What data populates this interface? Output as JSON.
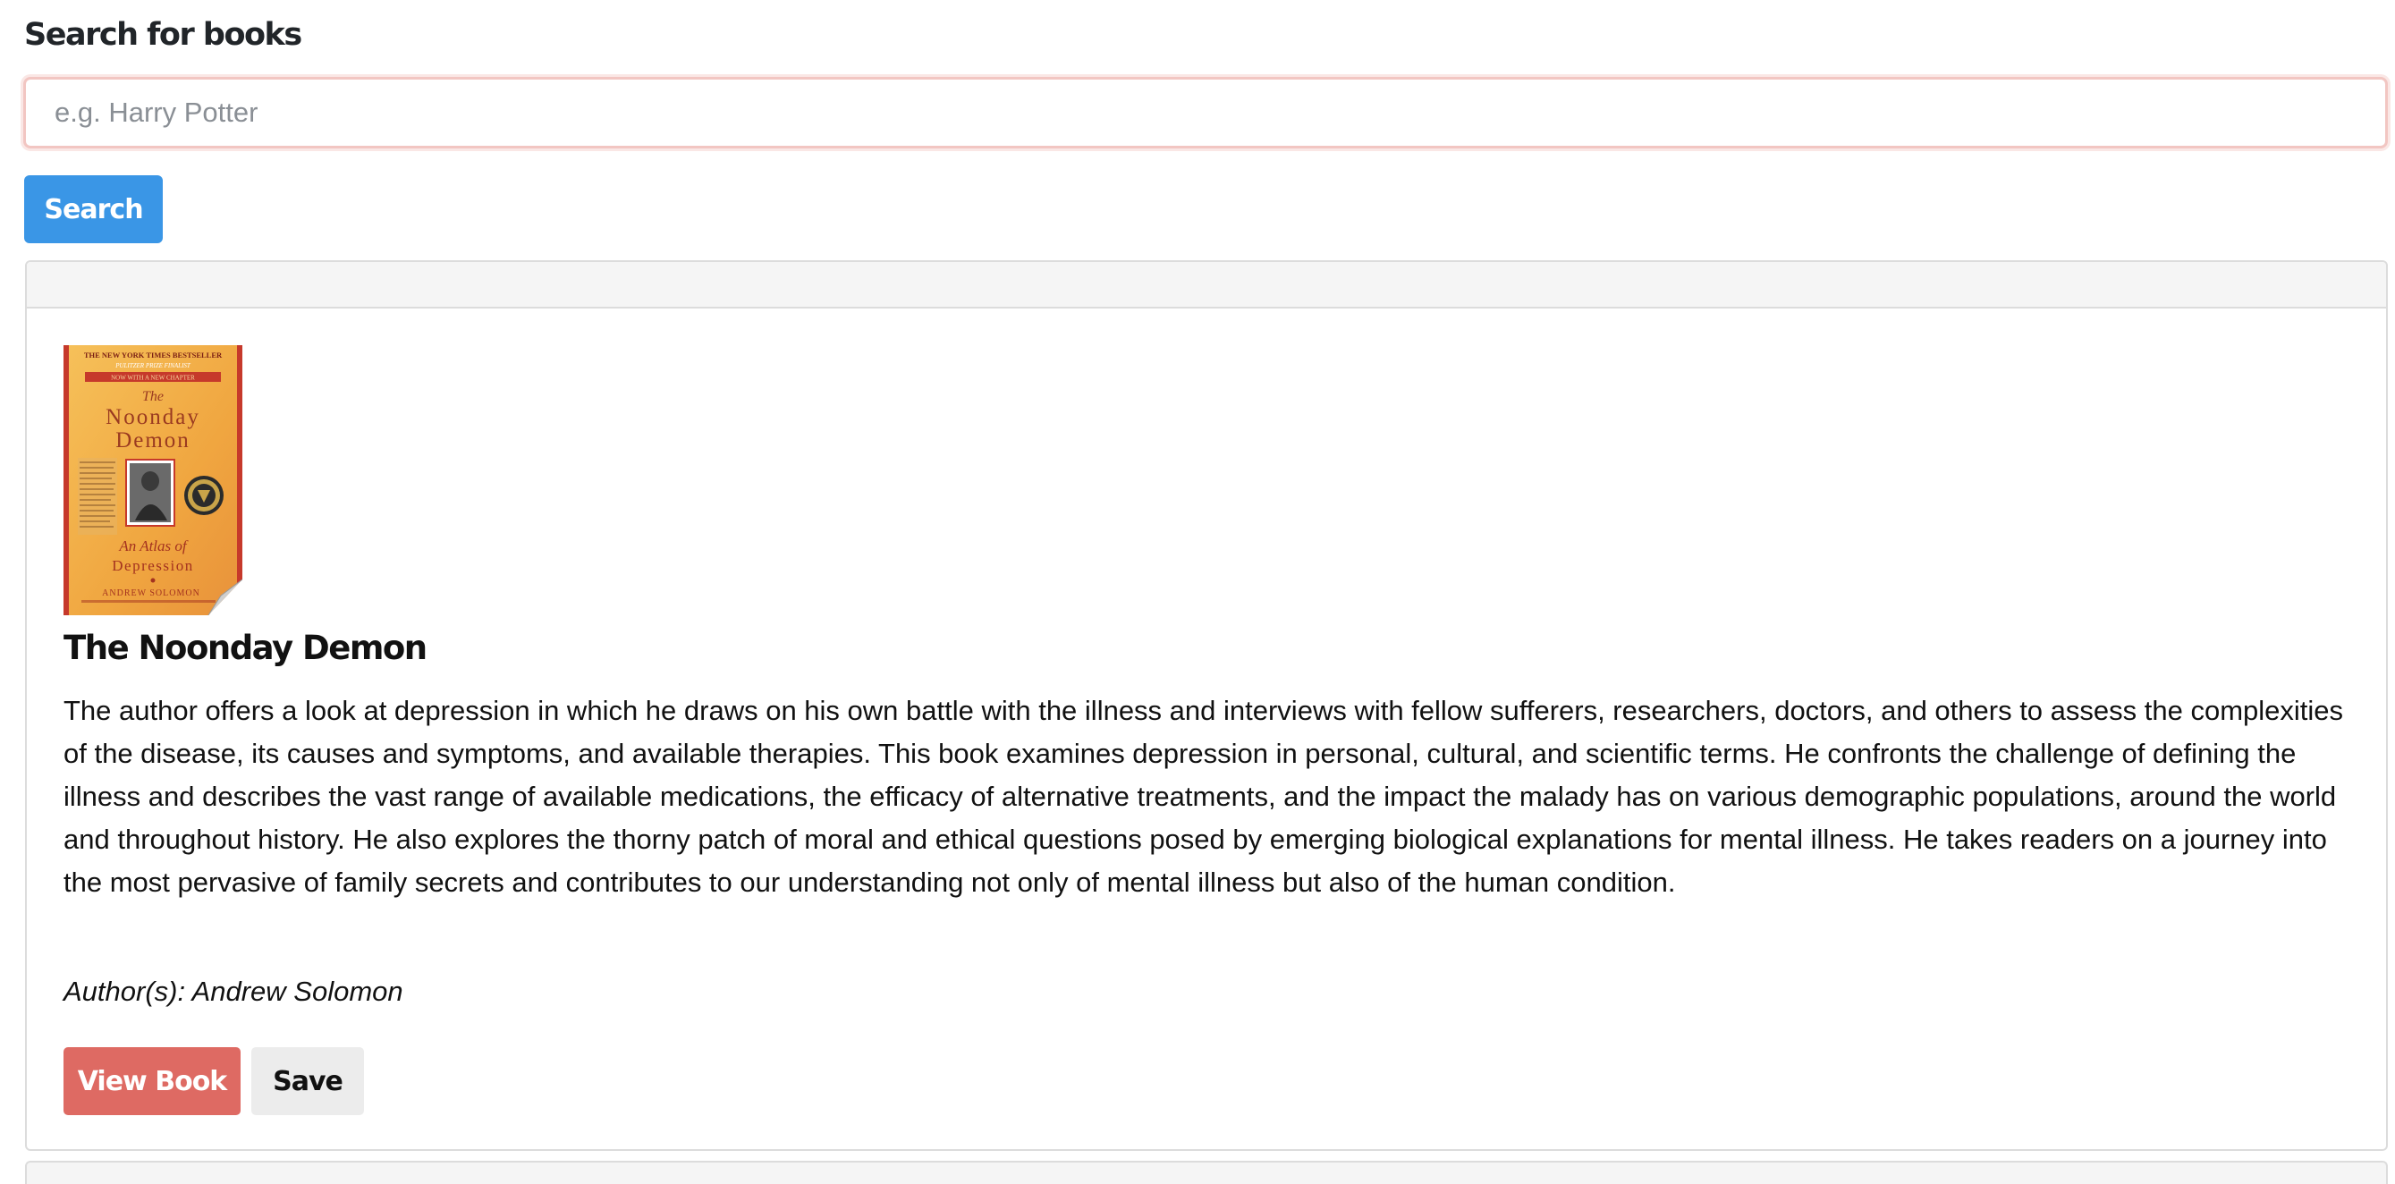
{
  "search": {
    "label": "Search for books",
    "placeholder": "e.g. Harry Potter",
    "value": "",
    "button_label": "Search"
  },
  "results": [
    {
      "cover": {
        "icon": "book-cover-image",
        "top_line": "THE NEW YORK TIMES BESTSELLER",
        "sub_line": "PULITZER PRIZE FINALIST",
        "banner": "NOW WITH A NEW CHAPTER",
        "title_small": "The",
        "title_line1": "Noonday",
        "title_line2": "Demon",
        "subtitle_line1": "An Atlas of",
        "subtitle_line2": "Depression",
        "author": "ANDREW SOLOMON"
      },
      "title": "The Noonday Demon",
      "description": "The author offers a look at depression in which he draws on his own battle with the illness and interviews with fellow sufferers, researchers, doctors, and others to assess the complexities of the disease, its causes and symptoms, and available therapies. This book examines depression in personal, cultural, and scientific terms. He confronts the challenge of defining the illness and describes the vast range of available medications, the efficacy of alternative treatments, and the impact the malady has on various demographic populations, around the world and throughout history. He also explores the thorny patch of moral and ethical questions posed by emerging biological explanations for mental illness. He takes readers on a journey into the most pervasive of family secrets and contributes to our understanding not only of mental illness but also of the human condition.",
      "authors": "Author(s): Andrew Solomon",
      "view_label": "View Book",
      "save_label": "Save"
    }
  ],
  "colors": {
    "primary": "#3a96e6",
    "danger": "#de6a63",
    "light": "#ececec",
    "input_focus_border": "#f2c6c2",
    "cover_bg": "#f2b04a",
    "cover_red": "#c6392b"
  }
}
